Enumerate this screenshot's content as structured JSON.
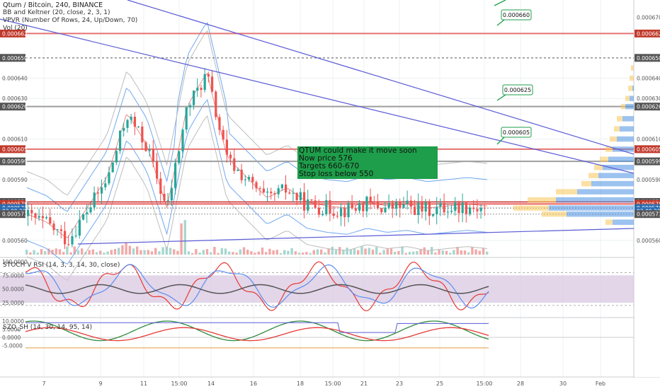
{
  "header": {
    "symbol_title": "Qtum / Bitcoin, 240, BINANCE",
    "indicators": [
      "BB and Keltner (20, close, 2, 3, 1)",
      "VPVR (Number Of Rows, 24, Up/Down, 70)",
      "Vol (20)"
    ]
  },
  "annotation": {
    "lines": [
      "QTUM could make it move soon",
      "Now price 576",
      "Targets 660-670",
      "Stop loss below 550"
    ]
  },
  "callouts": [
    "0.000660",
    "0.000625",
    "0.000605"
  ],
  "price_axis": {
    "ticks": [
      "0.000670",
      "0.000640",
      "0.000630",
      "0.000610",
      "0.000590",
      "0.000560"
    ],
    "tick_values": [
      670,
      640,
      630,
      610,
      590,
      560
    ],
    "badges": [
      {
        "label": "0.000662",
        "value": 662,
        "color": "#c0392b"
      },
      {
        "label": "0.000650",
        "value": 650,
        "color": "#555555"
      },
      {
        "label": "0.000626",
        "value": 626,
        "color": "#555555"
      },
      {
        "label": "0.000605",
        "value": 605,
        "color": "#c0392b"
      },
      {
        "label": "0.000599",
        "value": 599,
        "color": "#555555"
      },
      {
        "label": "0.000579",
        "value": 579,
        "color": "#555555"
      },
      {
        "label": "0.000578",
        "value": 578,
        "color": "#c0392b"
      },
      {
        "label": "0.000576",
        "value": 576,
        "color": "#2b6cb0"
      },
      {
        "label": "03:09:20",
        "value": 574.4,
        "color": "#2b6cb0"
      },
      {
        "label": "0.000573",
        "value": 573,
        "color": "#555555"
      }
    ]
  },
  "stoch": {
    "title": "STOCH V RSI (14, 3, 3, 14, 30, close)",
    "ticks": [
      "100.0000",
      "75.0000",
      "50.0000",
      "25.0000"
    ],
    "tick_values": [
      100,
      75,
      50,
      25
    ]
  },
  "szo": {
    "title": "SZO_SH (14, 30, 14, 95, 14)",
    "ticks": [
      "10.0000",
      "5.0000",
      "0.0000",
      "-5.0000"
    ],
    "tick_values": [
      10,
      5,
      0,
      -5
    ]
  },
  "time_axis": {
    "labels": [
      "7",
      "9",
      "11",
      "15:00",
      "14",
      "16",
      "18",
      "15:00",
      "21",
      "23",
      "25",
      "15:00",
      "28",
      "30",
      "Feb"
    ]
  },
  "colors": {
    "up": "#26a69a",
    "down": "#ef5350",
    "resistance": "#e57373",
    "trendline": "#5b5bd6",
    "callout_border": "#1e9e4a",
    "stoch_band": "#d7c4e0"
  },
  "chart_data": {
    "type": "candlestick",
    "title": "Qtum / Bitcoin, 240, BINANCE",
    "ylim": [
      0.000555,
      0.000672
    ],
    "horizontal_levels": [
      0.000662,
      0.00065,
      0.000626,
      0.000605,
      0.000599,
      0.000579,
      0.000578,
      0.000576,
      0.000573
    ],
    "price_path": [
      572,
      568,
      560,
      575,
      590,
      622,
      606,
      575,
      625,
      642,
      600,
      590,
      580,
      585,
      578,
      576,
      575,
      578,
      576,
      577,
      575,
      576,
      577,
      576
    ],
    "targets": [
      0.00066,
      0.000625,
      0.000605
    ]
  }
}
